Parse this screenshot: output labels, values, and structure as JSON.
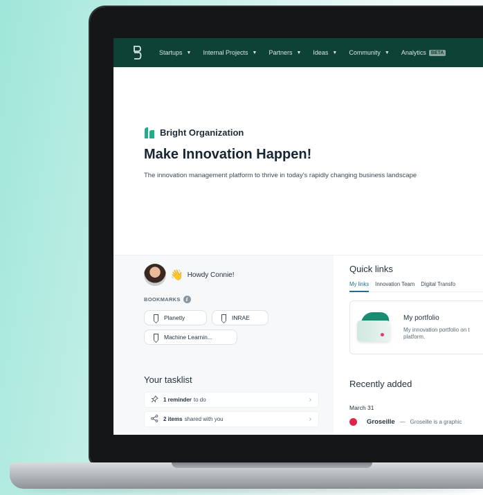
{
  "nav": {
    "logo_icon": "brand-logo-icon",
    "items": [
      {
        "label": "Startups",
        "caret": "▼"
      },
      {
        "label": "Internal Projects",
        "caret": "▼"
      },
      {
        "label": "Partners",
        "caret": "▼"
      },
      {
        "label": "Ideas",
        "caret": "▼"
      },
      {
        "label": "Community",
        "caret": "▼"
      }
    ],
    "analytics_label": "Analytics",
    "beta_badge": "BETA"
  },
  "hero": {
    "org_name": "Bright Organization",
    "title": "Make Innovation Happen!",
    "description": "The innovation management platform to thrive in today's rapidly changing business landscape"
  },
  "user": {
    "wave_emoji": "👋",
    "greeting": "Howdy Connie!"
  },
  "bookmarks": {
    "label": "BOOKMARKS",
    "info_glyph": "i",
    "items": [
      "Planetly",
      "INRAE",
      "Machine Learnin..."
    ]
  },
  "tasklist": {
    "title": "Your tasklist",
    "tasks": [
      {
        "icon": "pin-icon",
        "glyph": "📌",
        "count": "1 reminder",
        "text": "to do",
        "chevron": "›"
      },
      {
        "icon": "share-icon",
        "glyph": "⤳",
        "count": "2 items",
        "text": "shared with you",
        "chevron": "›"
      }
    ]
  },
  "quick_links": {
    "title": "Quick links",
    "tabs": [
      "My links",
      "Innovation Team",
      "Digital Transfo"
    ],
    "active_tab": 0,
    "card": {
      "title": "My portfolio",
      "desc_line1": "My innovation portfolio on t",
      "desc_line2": "platform."
    }
  },
  "recently_added": {
    "title": "Recently added",
    "date": "March 31",
    "item": {
      "name": "Groseille",
      "dash": "—",
      "desc": "Groseille is a graphic"
    }
  },
  "colors": {
    "nav_bg": "#0e4236",
    "brand_green": "#1a8c70",
    "accent_link": "#1d6f8b",
    "recent_dot": "#e0244a"
  }
}
